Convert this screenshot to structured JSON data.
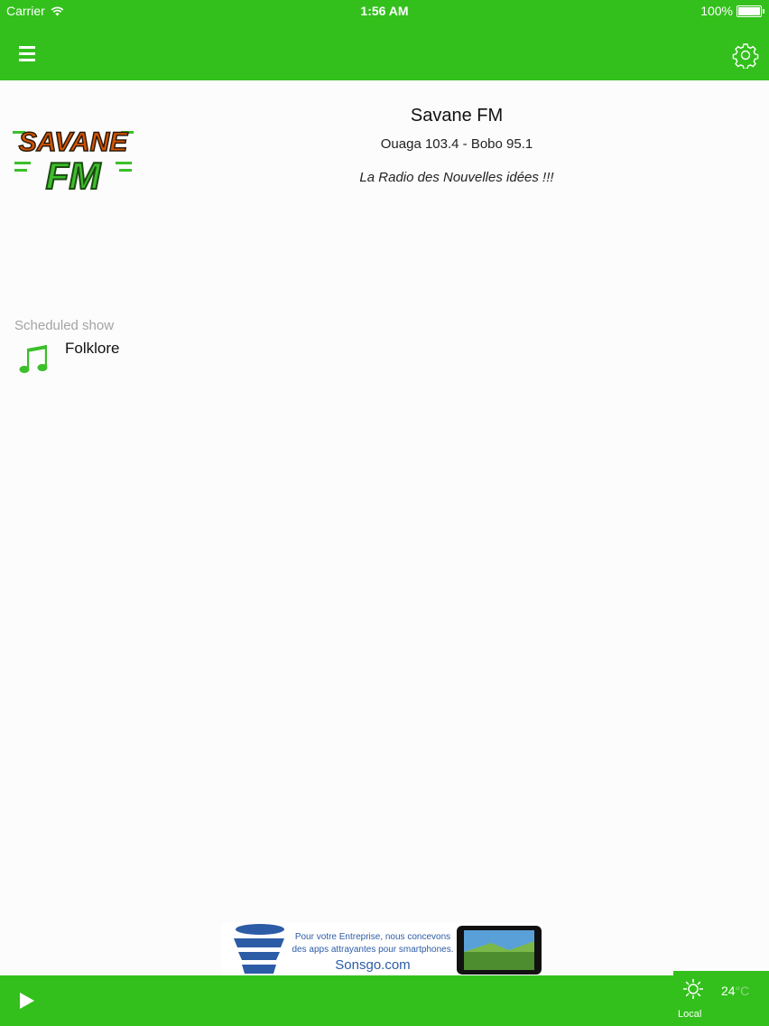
{
  "status_bar": {
    "carrier": "Carrier",
    "time": "1:56 AM",
    "battery": "100%"
  },
  "header": {
    "menu_icon": "hamburger-icon",
    "settings_icon": "gear-icon"
  },
  "station": {
    "logo_text_top": "SAVANE",
    "logo_text_bottom": "FM",
    "title": "Savane FM",
    "frequencies": "Ouaga 103.4 - Bobo 95.1",
    "slogan": "La Radio des Nouvelles idées !!!"
  },
  "schedule": {
    "label": "Scheduled show",
    "show": "Folklore",
    "icon": "music-note-icon"
  },
  "ad": {
    "line1": "Pour votre Entreprise, nous concevons",
    "line2": "des apps attrayantes pour smartphones.",
    "site": "Sonsgo.com"
  },
  "player": {
    "play_icon": "play-icon"
  },
  "weather": {
    "temperature": "24",
    "unit": "°C",
    "location": "Local",
    "icon": "sun-icon"
  },
  "colors": {
    "accent": "#33c01c",
    "logo_green": "#3bbf2a",
    "logo_red": "#c0392b",
    "ad_blue": "#2d5ca6"
  }
}
